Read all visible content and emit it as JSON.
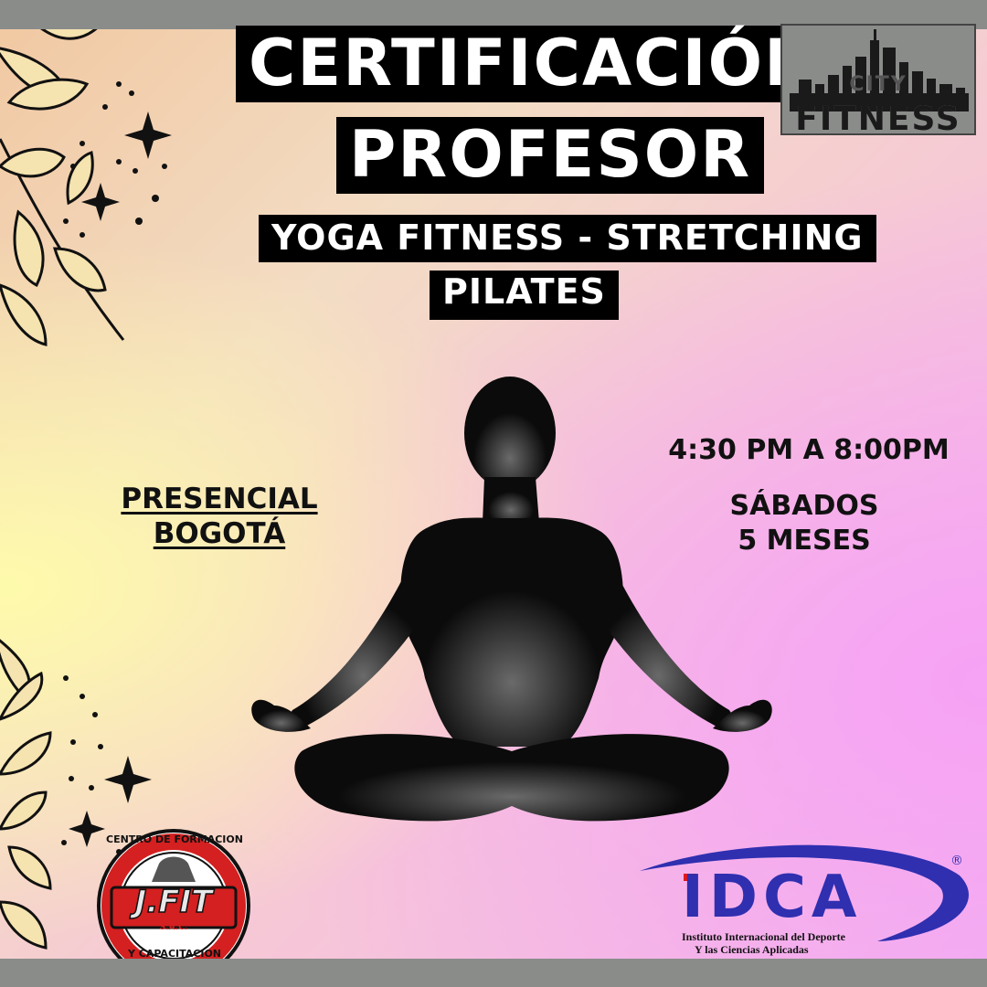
{
  "title": {
    "line1": "CERTIFICACIÓN",
    "line2": "PROFESOR",
    "subtitle_line1": "YOGA FITNESS - STRETCHING",
    "subtitle_line2": "PILATES"
  },
  "city_fitness_logo": {
    "word1": "CITY",
    "word2": "FITNESS"
  },
  "modalidad": {
    "line1": "PRESENCIAL ",
    "line2": "BOGOTÁ "
  },
  "horario": "4:30 PM A 8:00PM",
  "dias": {
    "line1": "SÁBADOS",
    "line2": "5 MESES"
  },
  "jfit_logo": {
    "top_text": "CENTRO DE FORMACION",
    "bottom_text": "Y CAPACITACION",
    "name": "J.FIT",
    "suffix": "S.A.C."
  },
  "idca_logo": {
    "letters": "IDCA",
    "registered": "®",
    "line1": "Instituto Internacional del Deporte",
    "line2": "Y las Ciencias Aplicadas"
  },
  "colors": {
    "frame": "#8a8c8a",
    "idca_blue": "#2f2fb0",
    "jfit_red": "#d42020",
    "text": "#111111"
  },
  "icons": [
    "sparkle-icon",
    "leaf-branch-icon",
    "meditation-silhouette-icon",
    "city-skyline-icon"
  ]
}
